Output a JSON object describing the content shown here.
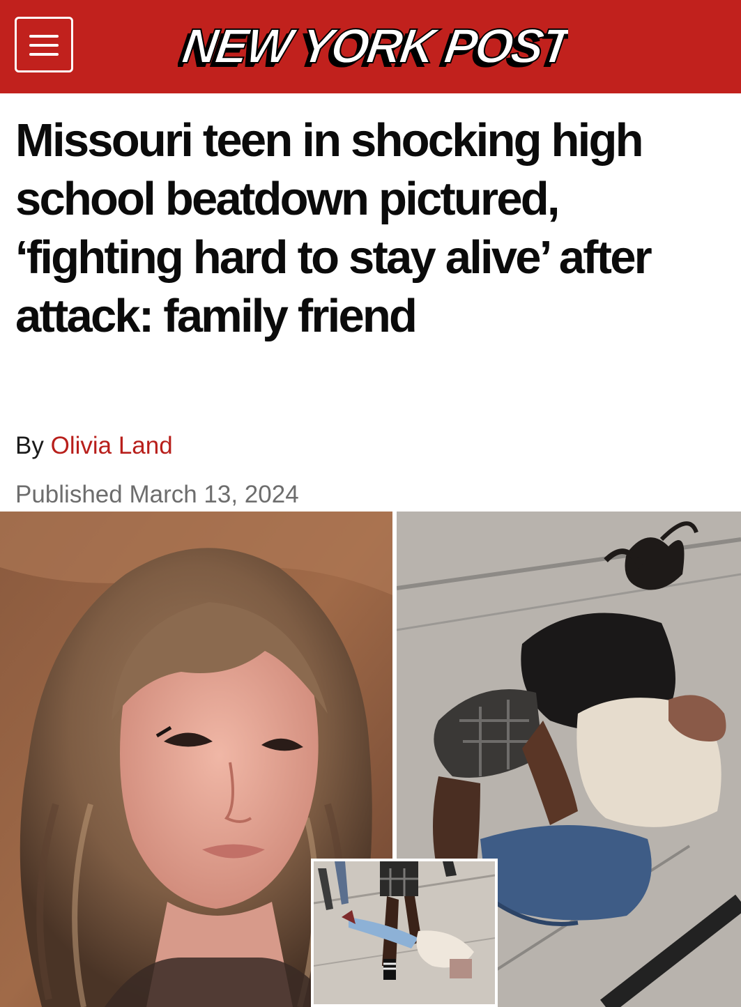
{
  "header": {
    "brand": "NEW YORK POST",
    "brand_color": "#c1211d",
    "menu_icon": "hamburger-menu-icon"
  },
  "article": {
    "headline": "Missouri teen in shocking high school beatdown pictured, ‘fighting hard to stay alive’ after attack: family friend",
    "byline_prefix": "By",
    "author": "Olivia Land",
    "published": "Published March 13, 2024"
  },
  "colors": {
    "accent": "#c1211d",
    "author_link": "#b81f1b",
    "headline_text": "#0b0b0b",
    "meta_text": "#6d6d6d"
  }
}
